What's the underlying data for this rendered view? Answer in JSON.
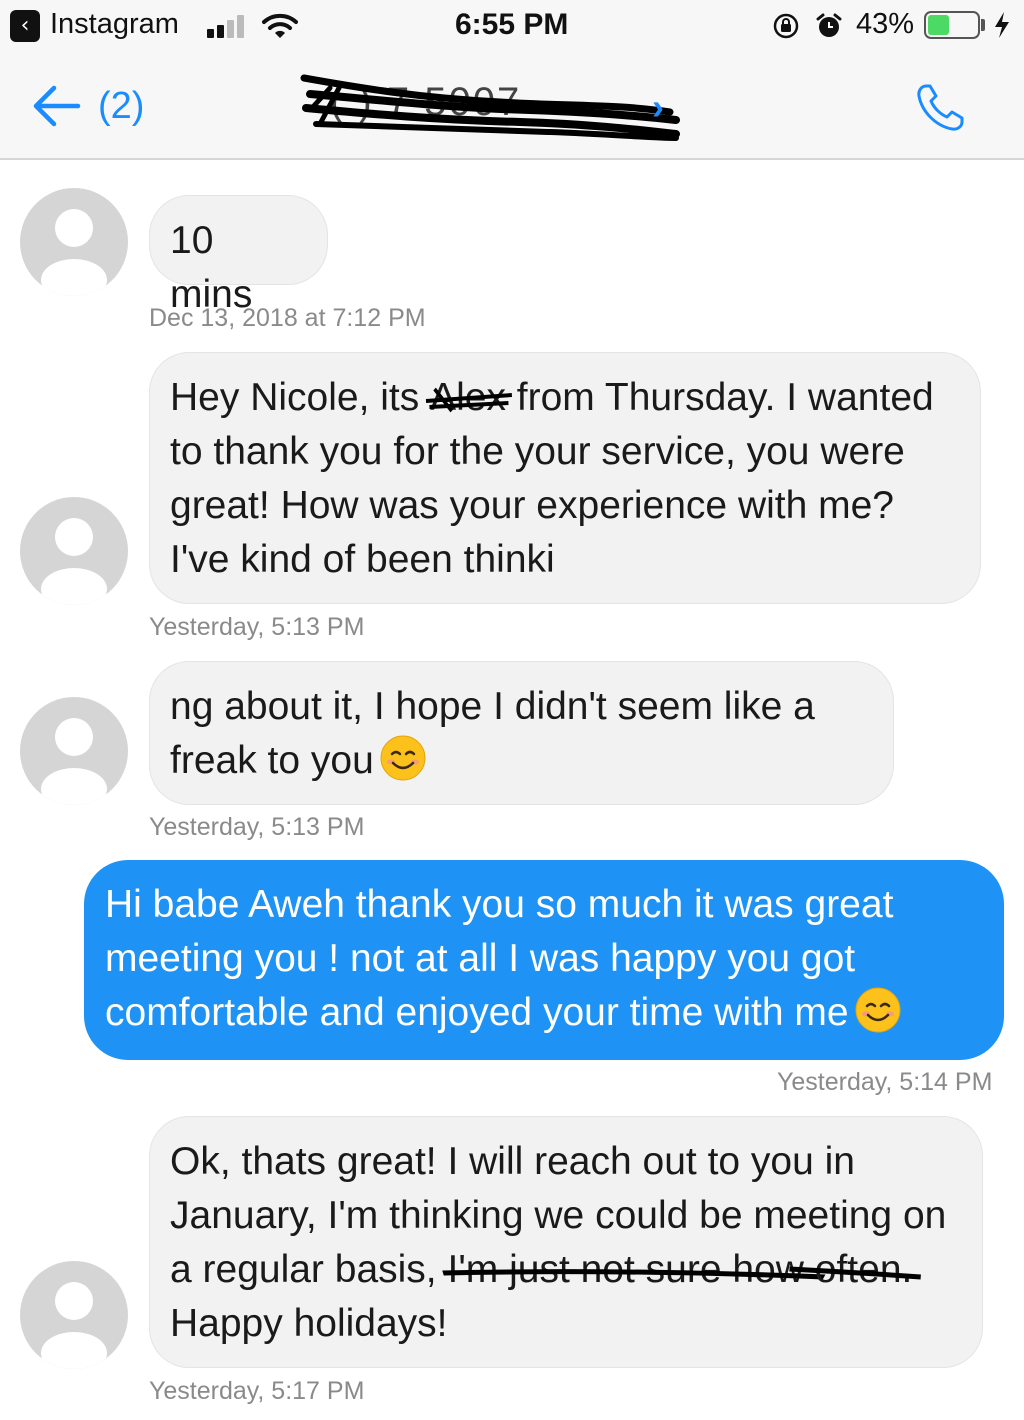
{
  "status_bar": {
    "back_app": "Instagram",
    "back_icon": "chevron-left-icon",
    "time": "6:55 PM",
    "battery_percent": "43%",
    "battery_level": 0.43,
    "battery_color": "#4cd964",
    "signal_bars_active": 2,
    "signal_bars_total": 4
  },
  "header": {
    "back_count": "(2)",
    "contact_name_redacted": "(     ) 7     5007",
    "accent": "#1a8cff"
  },
  "messages": [
    {
      "direction": "incoming",
      "text": "10 mins",
      "timestamp": "Dec 13, 2018 at 7:12 PM"
    },
    {
      "direction": "incoming",
      "text_before_strike": "Hey Nicole, its ",
      "struck_text": "Alex",
      "text_after_strike": " from Thursday. I wanted to thank you for the your service, you were great! How was your experience with me? I've kind of been thinki",
      "timestamp": "Yesterday, 5:13 PM"
    },
    {
      "direction": "incoming",
      "text": "ng about it, I hope I didn't seem like a freak to you",
      "emoji": "smiling-face-emoji",
      "timestamp": "Yesterday, 5:13 PM"
    },
    {
      "direction": "outgoing",
      "text": "Hi babe Aweh thank you so much it was great meeting you ! not at all I was happy you got comfortable and enjoyed your time with me",
      "emoji": "smiling-face-emoji",
      "bubble_color": "#1e93f5",
      "timestamp": "Yesterday, 5:14 PM"
    },
    {
      "direction": "incoming",
      "text_before_strike": "Ok, thats great! I will reach out to you in January, I'm thinking we could be meeting on a regular basis, ",
      "struck_text_1": "I'm just not sure how",
      "struck_text_2": "often.",
      "text_after_strike": " Happy holidays!",
      "timestamp": "Yesterday, 5:17 PM"
    }
  ]
}
